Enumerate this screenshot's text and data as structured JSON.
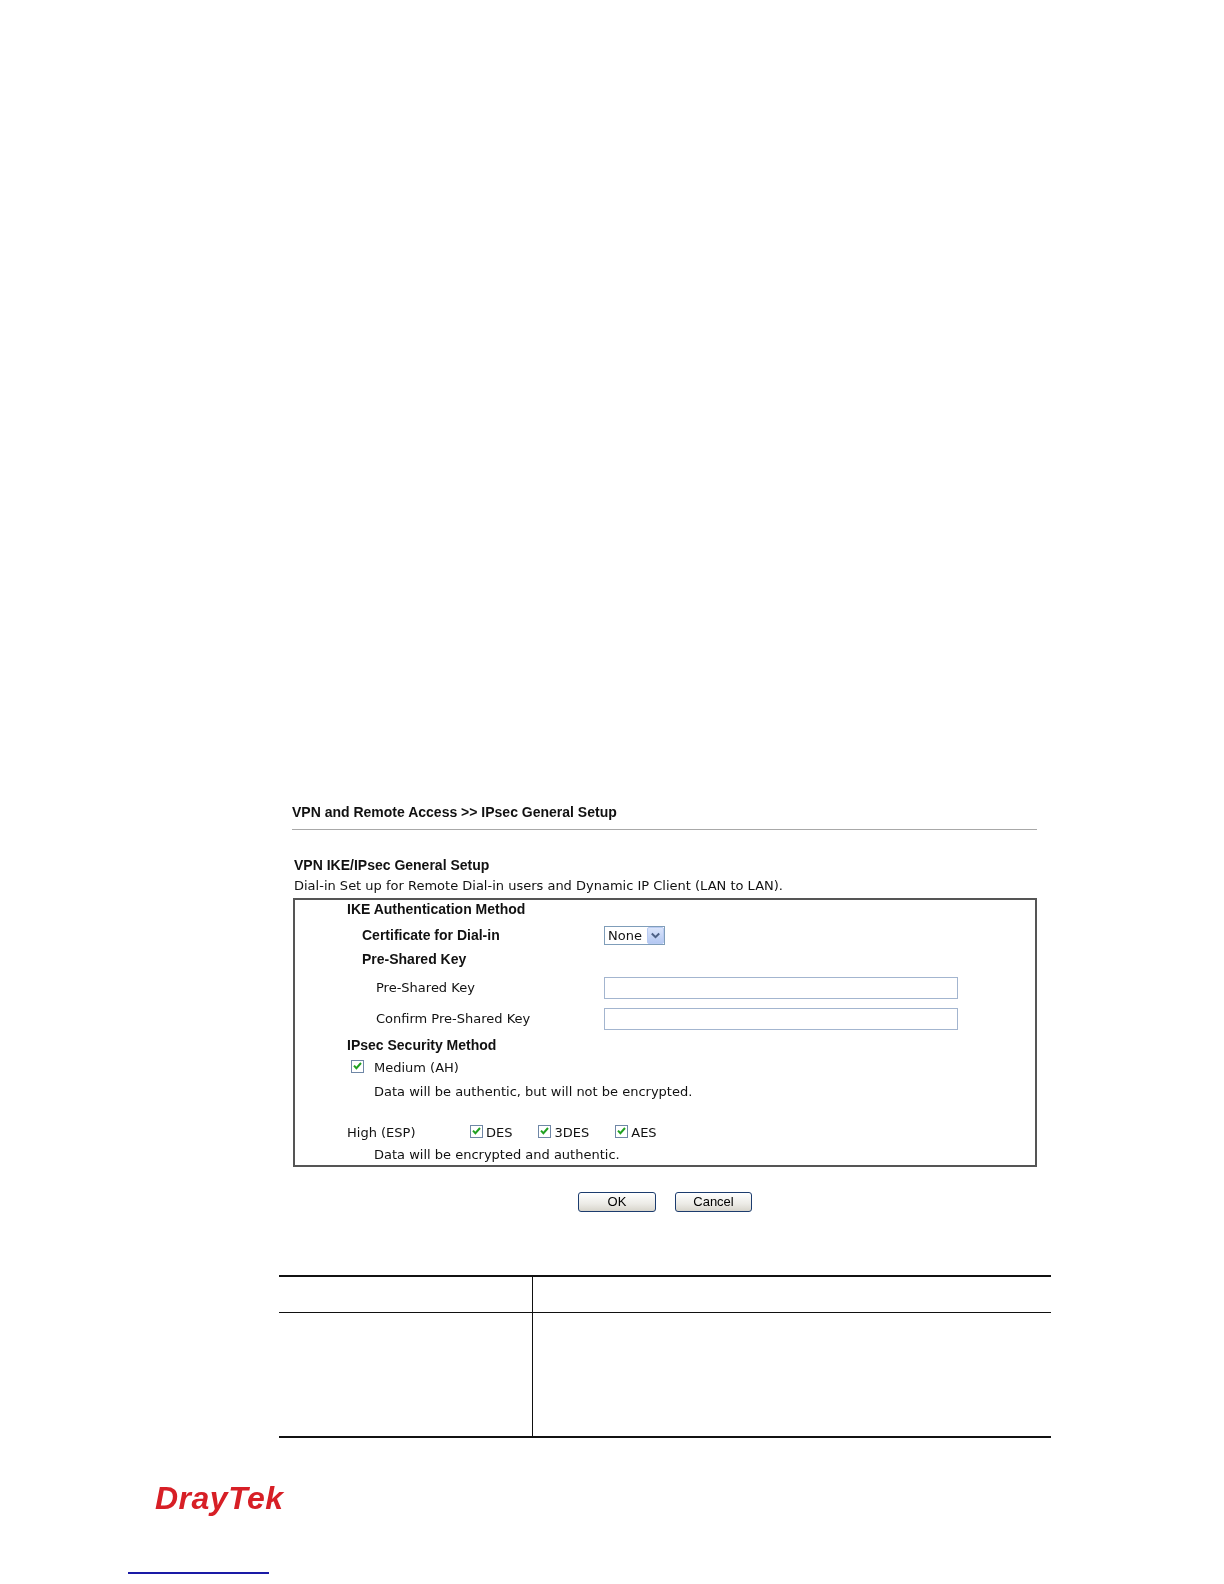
{
  "page_title": "VPN and Remote Access >> IPsec General Setup",
  "section": {
    "title": "VPN IKE/IPsec General Setup",
    "description": "Dial-in Set up for Remote Dial-in users and Dynamic IP Client (LAN to LAN)."
  },
  "ike_authentication": {
    "heading": "IKE Authentication Method",
    "certificate": {
      "label": "Certificate for Dial-in",
      "value": "None"
    },
    "pre_shared_key": {
      "heading": "Pre-Shared Key",
      "fields": [
        {
          "label": "Pre-Shared Key"
        },
        {
          "label": "Confirm Pre-Shared Key"
        }
      ]
    }
  },
  "ipsec_security": {
    "heading": "IPsec Security Method",
    "medium": {
      "label": "Medium (AH)",
      "checked": true,
      "note": "Data will be authentic, but will not be encrypted."
    },
    "high": {
      "label": "High (ESP)",
      "options": [
        {
          "label": "DES",
          "checked": true
        },
        {
          "label": "3DES",
          "checked": true
        },
        {
          "label": "AES",
          "checked": true
        }
      ],
      "note": "Data will be encrypted and authentic."
    }
  },
  "buttons": [
    {
      "label": "OK"
    },
    {
      "label": "Cancel"
    }
  ],
  "logo": {
    "text": "DrayTek"
  }
}
